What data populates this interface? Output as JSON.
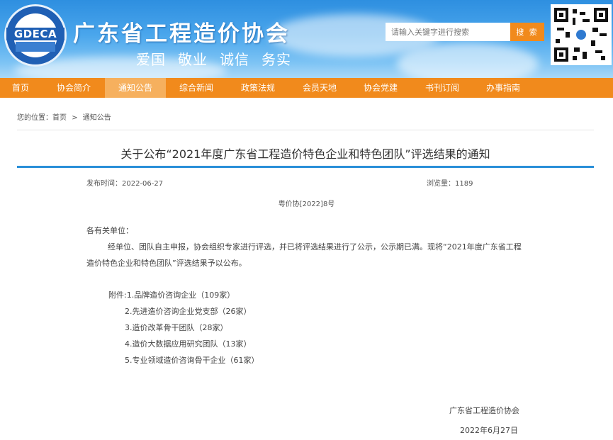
{
  "header": {
    "logo_text": "GDECA",
    "site_title": "广东省工程造价协会",
    "motto": [
      "爱国",
      "敬业",
      "诚信",
      "务实"
    ],
    "search_placeholder": "请输入关键字进行搜索",
    "search_button": "搜 索"
  },
  "nav": {
    "items": [
      "首页",
      "协会简介",
      "通知公告",
      "综合新闻",
      "政策法规",
      "会员天地",
      "协会党建",
      "书刊订阅",
      "办事指南"
    ],
    "active_index": 2
  },
  "breadcrumb": {
    "prefix": "您的位置：首页",
    "separator": ">",
    "current": "通知公告"
  },
  "article": {
    "title": "关于公布“2021年度广东省工程造价特色企业和特色团队”评选结果的通知",
    "publish_time": "发布时间：2022-06-27",
    "views": "浏览量：1189",
    "doc_number": "粤价协[2022]8号",
    "salutation": "各有关单位：",
    "paragraph": "经单位、团队自主申报，协会组织专家进行评选，并已将评选结果进行了公示，公示期已满。现将“2021年度广东省工程造价特色企业和特色团队”评选结果予以公布。",
    "attachments": [
      "附件:1.品牌造价咨询企业（109家）",
      "2.先进造价咨询企业党支部（26家）",
      "3.造价改革骨干团队（28家）",
      "4.造价大数据应用研究团队（13家）",
      "5.专业领域造价咨询骨干企业（61家）"
    ],
    "signature": "广东省工程造价协会",
    "sign_date": "2022年6月27日"
  },
  "colors": {
    "nav_bg": "#f18a1c",
    "nav_active": "#f6b05e",
    "title_bar": "#2a8fd8",
    "header_blue": "#2e8fe0"
  }
}
